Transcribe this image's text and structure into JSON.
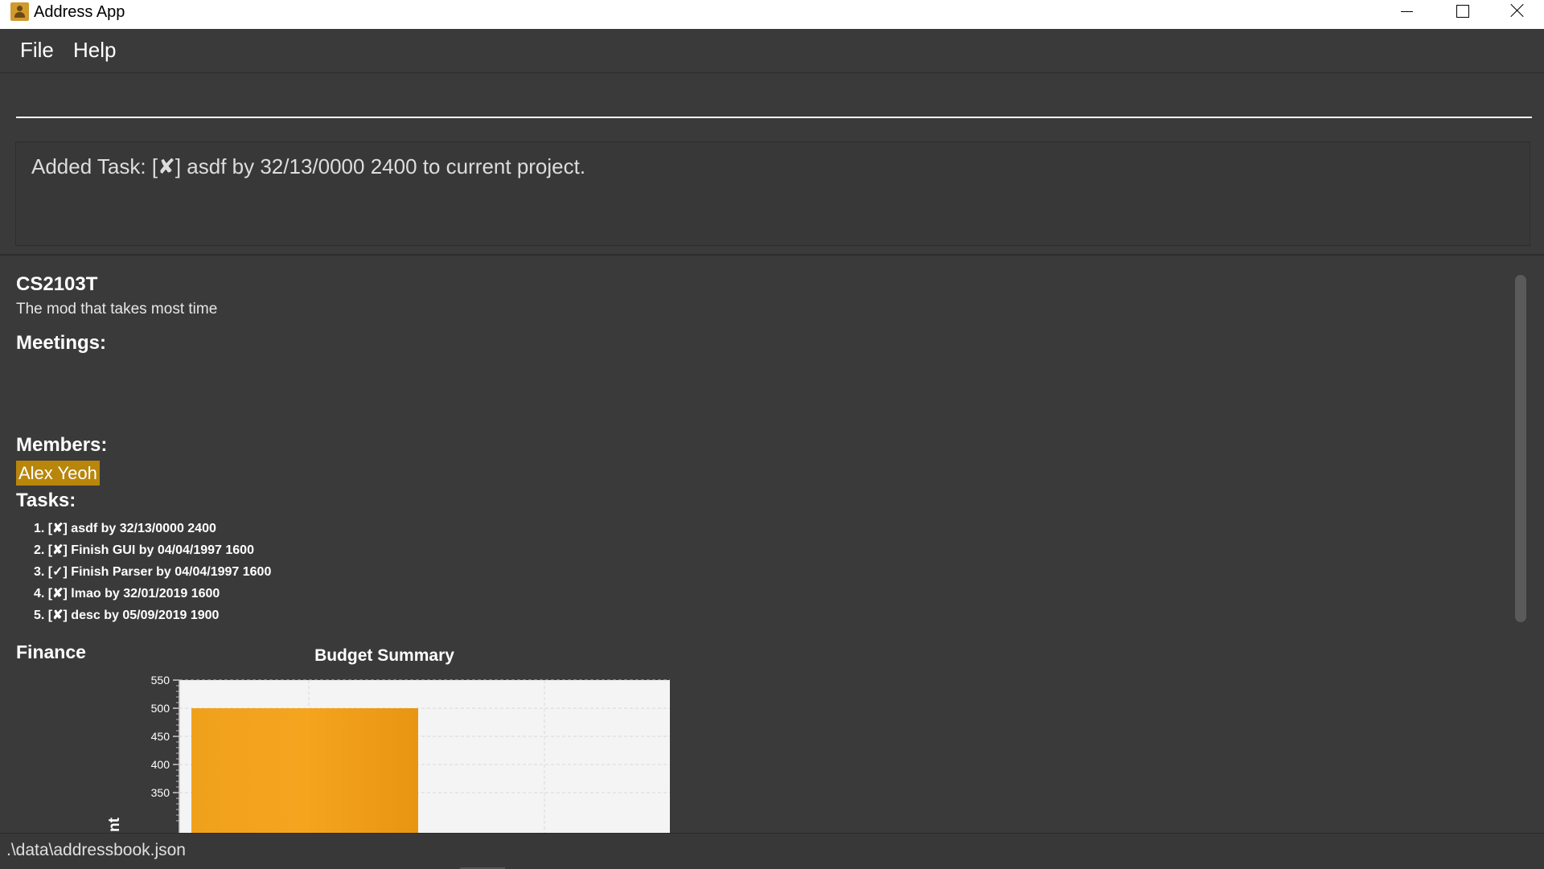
{
  "window": {
    "title": "Address App"
  },
  "menu": {
    "items": [
      "File",
      "Help"
    ]
  },
  "command": {
    "value": ""
  },
  "result": {
    "message": "Added Task: [✘] asdf by 32/13/0000 2400 to current project."
  },
  "project": {
    "title": "CS2103T",
    "description": "The mod that takes most time",
    "meetings_heading": "Meetings:",
    "members_heading": "Members:",
    "members": [
      "Alex Yeoh"
    ],
    "tasks_heading": "Tasks:",
    "tasks": [
      "1. [✘] asdf by 32/13/0000 2400",
      "2. [✘] Finish GUI by 04/04/1997 1600",
      "3. [✓] Finish Parser by 04/04/1997 1600",
      "4. [✘] lmao by 32/01/2019 1600",
      "5. [✘] desc by 05/09/2019 1900"
    ],
    "finance_heading": "Finance"
  },
  "chart_data": {
    "type": "bar",
    "title": "Budget Summary",
    "ylabel": "nt",
    "yticks": [
      550,
      500,
      450,
      400,
      350
    ],
    "ylim": [
      300,
      550
    ],
    "categories": [
      ""
    ],
    "values": [
      500
    ],
    "grid": true,
    "bar_color": "#f5a41e"
  },
  "status": {
    "path": ".\\data\\addressbook.json"
  },
  "colors": {
    "background": "#3a3a3a",
    "member_chip": "#b8860b",
    "bar": "#f5a41e"
  }
}
